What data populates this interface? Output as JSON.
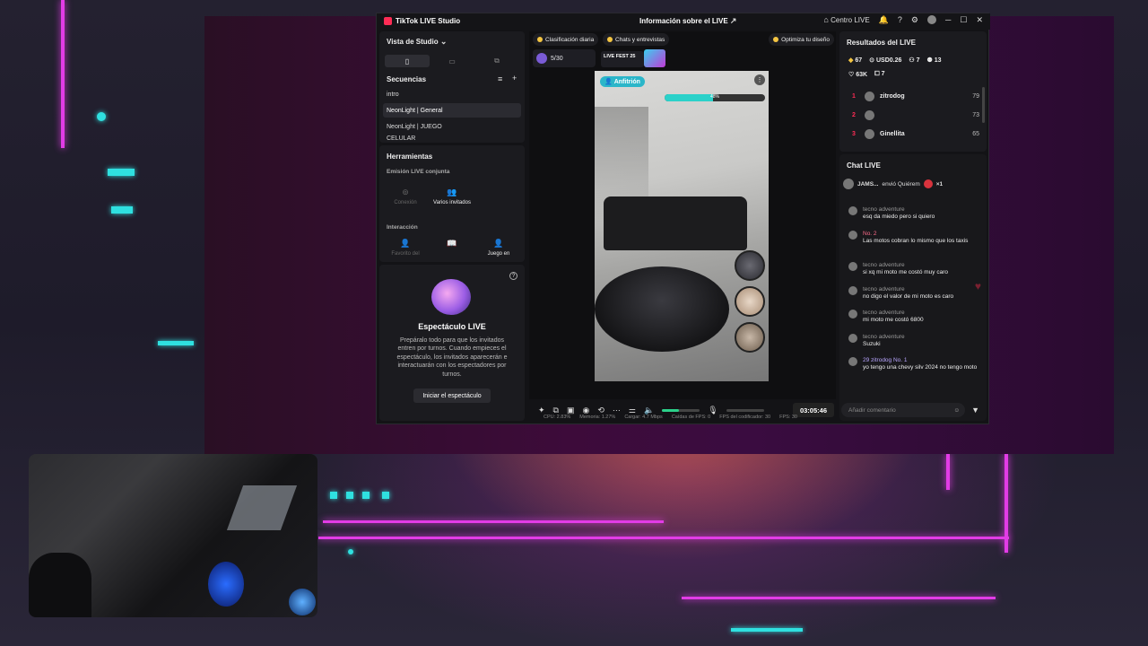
{
  "window": {
    "app_title": "TikTok LIVE Studio",
    "center_title": "Información sobre el LIVE",
    "centro_live": "Centro LIVE"
  },
  "left": {
    "vista": "Vista de Studio",
    "secuencias": "Secuencias",
    "seq_items": [
      "intro",
      "NeonLight | General",
      "NeonLight | JUEGO",
      "CELULAR"
    ],
    "herramientas": "Herramientas",
    "emision": "Emisión LIVE conjunta",
    "conexion": "Conexión",
    "varios": "Varios invitados",
    "interaccion": "Interacción",
    "favorito": "Favorito del",
    "juego": "Juego en",
    "espectaculo_title": "Espectáculo LIVE",
    "espectaculo_desc": "Prepáralo todo para que los invitados entren por turnos. Cuando empieces el espectáculo, los invitados aparecerán e interactuarán con los espectadores por turnos.",
    "iniciar": "Iniciar el espectáculo"
  },
  "center": {
    "chips": [
      "Clasificación diaria",
      "Chats y entrevistas",
      "Optimiza tu diseño"
    ],
    "progress": "5/30",
    "fest": "LIVE FEST 25",
    "host": "Anfitrión",
    "goal_pct": "48%",
    "timer": "03:05:46",
    "volume_level": 0.45,
    "status": [
      "CPU: 2.83%",
      "Memoria: 1.27%",
      "Cargar: 4.7 Mbps",
      "Caídas de FPS: 0",
      "FPS del codificador: 30",
      "FPS: 30"
    ]
  },
  "results": {
    "title": "Resultados del LIVE",
    "stats": [
      "67",
      "USD0.26",
      "7",
      "13",
      "63K",
      "7"
    ],
    "ranks": [
      {
        "n": "1",
        "name": "zitrodog",
        "score": "79"
      },
      {
        "n": "2",
        "name": "",
        "score": "73"
      },
      {
        "n": "3",
        "name": "Ginellita",
        "score": "65"
      }
    ]
  },
  "chat": {
    "title": "Chat LIVE",
    "gift_user": "JAMS...",
    "gift_text": "envió Quiérem",
    "gift_count": "×1",
    "messages": [
      {
        "user": "tecno adventure",
        "text": "esq da miedo pero si quiero"
      },
      {
        "user": "No. 2",
        "text": "Las motos cobran lo mismo que los taxis"
      },
      {
        "user": "tecno adventure",
        "text": "si xq mi moto me costó muy caro"
      },
      {
        "user": "tecno adventure",
        "text": "no digo el valor de mi moto es caro"
      },
      {
        "user": "tecno adventure",
        "text": "mi moto me costó 6800"
      },
      {
        "user": "tecno adventure",
        "text": "Suzuki"
      },
      {
        "user": "29 zitrodog No. 1",
        "text": "yo tengo una chevy silv 2024 no tengo moto"
      }
    ],
    "placeholder": "Añadir comentario"
  },
  "colors": {
    "accent": "#fe2c55",
    "teal": "#2bb6c9",
    "neon_pink": "#e23ce6",
    "neon_cyan": "#2fe0e0"
  }
}
